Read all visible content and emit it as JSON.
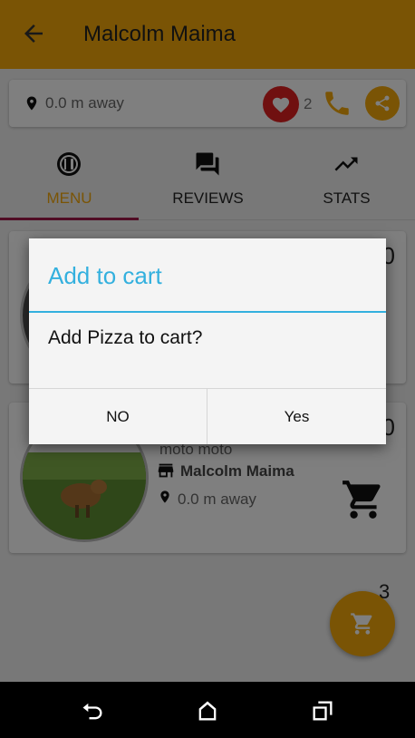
{
  "appbar": {
    "title": "Malcolm Maima",
    "back_icon": "arrow-back-icon",
    "color": "#F5A90A"
  },
  "info": {
    "distance": "0.0 m away",
    "like_count": "2"
  },
  "tabs": [
    {
      "label": "MENU",
      "icon": "restaurant-icon",
      "active": true
    },
    {
      "label": "REVIEWS",
      "icon": "forum-icon",
      "active": false
    },
    {
      "label": "STATS",
      "icon": "trending-up-icon",
      "active": false
    }
  ],
  "items": [
    {
      "price_fragment": "0"
    },
    {
      "price_fragment": "0",
      "description": "moto moto",
      "store": "Malcolm Maima",
      "distance": "0.0 m away"
    }
  ],
  "cart": {
    "badge": "3"
  },
  "dialog": {
    "title": "Add to cart",
    "message": "Add Pizza to cart?",
    "negative": "NO",
    "positive": "Yes",
    "title_color": "#33B0DE"
  }
}
